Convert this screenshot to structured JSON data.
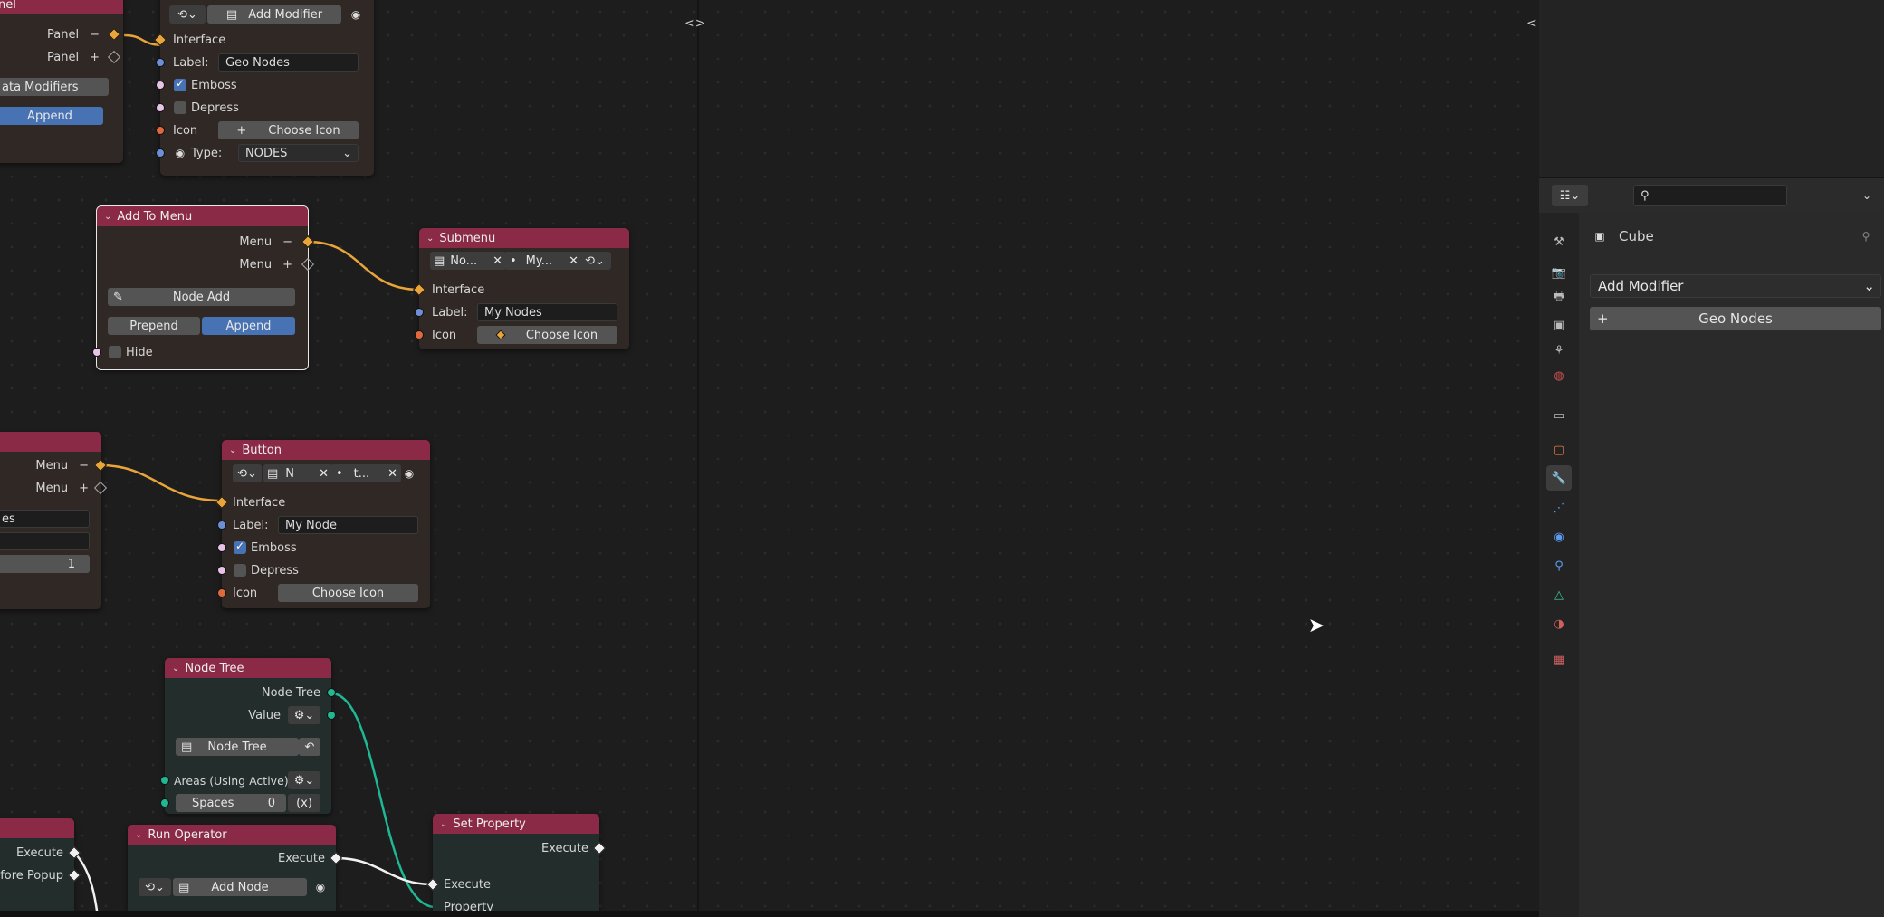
{
  "colors": {
    "node_header": "#8a2a46",
    "accent_blue": "#4772b3",
    "socket_menu": "#e9a43a",
    "socket_teal": "#1fb894"
  },
  "nodes": {
    "panel_partial": {
      "title": "nel",
      "out1": "Panel",
      "out2": "Panel",
      "button": "ata Modifiers",
      "append": "Append"
    },
    "add_modifier_node": {
      "button": "Add Modifier",
      "interface": "Interface",
      "label_caption": "Label:",
      "label_value": "Geo Nodes",
      "emboss": "Emboss",
      "depress": "Depress",
      "icon": "Icon",
      "choose_icon": "Choose Icon",
      "type_caption": "Type:",
      "type_value": "NODES"
    },
    "add_to_menu": {
      "title": "Add To Menu",
      "out1": "Menu",
      "out2": "Menu",
      "button": "Node Add",
      "prepend": "Prepend",
      "append": "Append",
      "hide": "Hide"
    },
    "submenu": {
      "title": "Submenu",
      "chip1": "No...",
      "chip2": "My...",
      "interface": "Interface",
      "label_caption": "Label:",
      "label_value": "My Nodes",
      "icon": "Icon",
      "choose_icon": "Choose Icon"
    },
    "menu_partial": {
      "out1": "Menu",
      "out2": "Menu",
      "field1": "es",
      "field3": "1"
    },
    "button_node": {
      "title": "Button",
      "chip1": "N",
      "chip2": "t...",
      "interface": "Interface",
      "label_caption": "Label:",
      "label_value": "My Node",
      "emboss": "Emboss",
      "depress": "Depress",
      "icon": "Icon",
      "choose_icon": "Choose Icon"
    },
    "node_tree": {
      "title": "Node Tree",
      "out1": "Node Tree",
      "out2": "Value",
      "button": "Node Tree",
      "areas": "Areas (Using Active)",
      "spaces": "Spaces",
      "spaces_value": "0",
      "x_toggle": "(x)"
    },
    "execute_partial": {
      "out1": "Execute",
      "out2": "efore Popup"
    },
    "run_operator": {
      "title": "Run Operator",
      "out1": "Execute",
      "button": "Add Node"
    },
    "set_property": {
      "title": "Set Property",
      "out1": "Execute",
      "in1": "Execute",
      "in2": "Property"
    }
  },
  "properties": {
    "object_name": "Cube",
    "add_modifier": "Add Modifier",
    "geo_nodes_button": "Geo Nodes",
    "tabs": [
      "tool-icon",
      "render-icon",
      "output-icon",
      "view-layer-icon",
      "scene-icon",
      "world-icon",
      "collection-icon",
      "object-icon",
      "modifier-icon",
      "particles-icon",
      "physics-icon",
      "constraints-icon",
      "data-icon",
      "material-icon",
      "texture-icon"
    ]
  }
}
